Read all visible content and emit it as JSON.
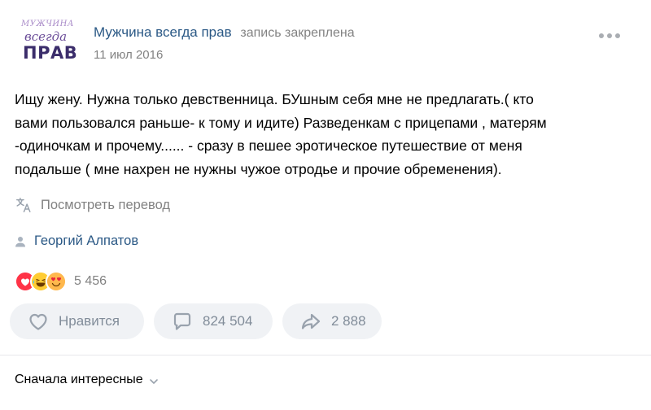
{
  "header": {
    "author": "Мужчина всегда прав",
    "status": "запись закреплена",
    "date": "11 июл 2016"
  },
  "avatar": {
    "line1": "МУЖЧИНА",
    "line2": "всегда",
    "line3": "ПРАВ"
  },
  "post": {
    "lines": [
      "Ищу жену. Нужна только девственница. БУшным себя мне не предлагать.( кто",
      "вами пользовался раньше- к тому и идите) Разведенкам с прицепами , матерям",
      "-одиночкам и прочему...... - сразу в пешее эротическое путешествие от меня",
      "подальше ( мне нахрен не нужны чужое отродье и прочие обременения)."
    ]
  },
  "translate": {
    "label": "Посмотреть перевод"
  },
  "signer": {
    "name": "Георгий Алпатов"
  },
  "reactions": {
    "count": "5 456"
  },
  "actions": {
    "like_label": "Нравится",
    "comments_count": "824 504",
    "shares_count": "2 888"
  },
  "sort": {
    "label": "Сначала интересные"
  },
  "colors": {
    "link": "#2a5885",
    "muted": "#828282",
    "button_bg": "#f0f2f5",
    "heart": "#ff3347"
  }
}
